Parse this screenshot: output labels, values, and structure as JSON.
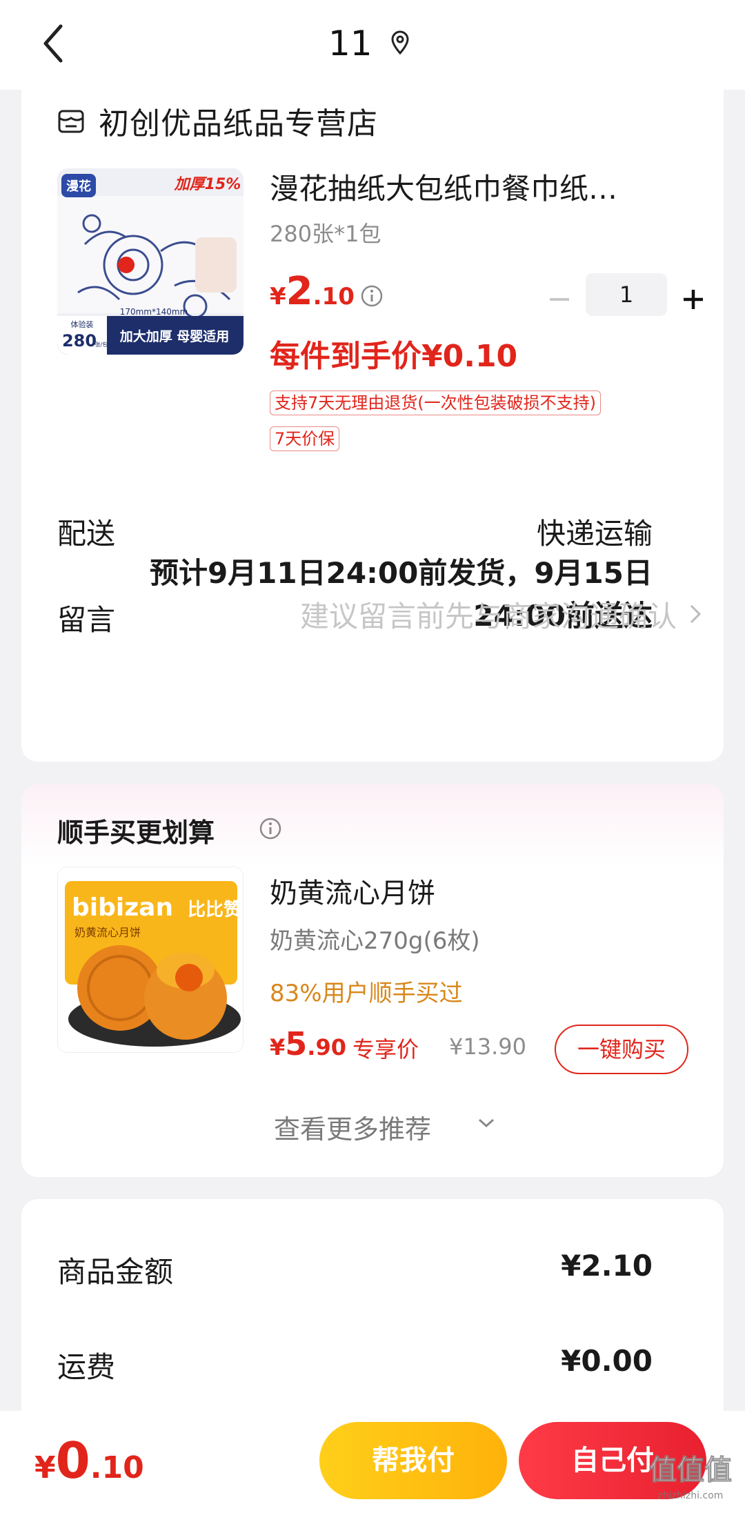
{
  "header": {
    "title": "11",
    "back_icon": "chevron-left-icon",
    "location_icon": "location-pin-icon"
  },
  "order": {
    "store_name": "初创优品纸品专营店",
    "store_icon": "store-icon",
    "product": {
      "title": "漫花抽纸大包纸巾餐巾纸…",
      "spec": "280张*1包",
      "price_symbol": "¥",
      "price_int": "2",
      "price_dec": ".10",
      "quantity": "1",
      "final_price": "每件到手价¥0.10",
      "tags": [
        "支持7天无理由退货(一次性包装破损不支持)",
        "7天价保"
      ],
      "image_text": {
        "brand": "漫花",
        "thicker": "加厚15%",
        "size": "170mm*140mm",
        "count_label": "体验装",
        "count": "280",
        "count_unit": "张/包",
        "slogan": "加大加厚 母婴适用"
      }
    },
    "delivery": {
      "label": "配送",
      "method": "快递运输",
      "eta": "预计9月11日24:00前发货，9月15日24:00前送达"
    },
    "message": {
      "label": "留言",
      "placeholder": "建议留言前先与商家沟通确认"
    }
  },
  "recommendation": {
    "title": "顺手买更划算",
    "item": {
      "name": "奶黄流心月饼",
      "spec": "奶黄流心270g(6枚)",
      "social": "83%用户顺手买过",
      "price_symbol": "¥",
      "price_int": "5",
      "price_dec": ".90",
      "exclusive": "专享价",
      "original_price": "¥13.90",
      "buy_label": "一键购买",
      "image_text": {
        "brand": "bibizan",
        "brand_cn": "比比赞",
        "product": "奶黄流心月饼"
      }
    },
    "more_label": "查看更多推荐"
  },
  "summary": {
    "goods_label": "商品金额",
    "goods_value": "¥2.10",
    "shipping_label": "运费",
    "shipping_value": "¥0.00"
  },
  "footer": {
    "price_symbol": "¥",
    "price_int": "0",
    "price_dec": ".10",
    "help_pay": "帮我付",
    "self_pay": "自己付"
  },
  "watermark": {
    "text": "值值值",
    "sub": "zhizhizhi.com"
  },
  "colors": {
    "accent_red": "#e1251b",
    "orange": "#d8871a",
    "yellow_button": "#ffc012",
    "red_button": "#f02a37"
  }
}
